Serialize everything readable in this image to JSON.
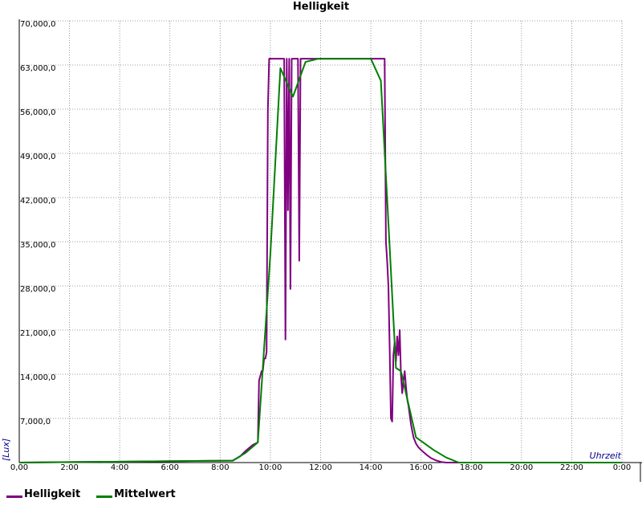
{
  "chart_data": {
    "type": "line",
    "title": "Helligkeit",
    "xlabel": "Uhrzeit",
    "ylabel": "[Lux]",
    "xlim": [
      0,
      24
    ],
    "ylim": [
      0,
      70000
    ],
    "grid": true,
    "legend_position": "bottom-left",
    "x_ticks": [
      {
        "value": 0,
        "label": "0,00"
      },
      {
        "value": 2,
        "label": "2:00"
      },
      {
        "value": 4,
        "label": "4:00"
      },
      {
        "value": 6,
        "label": "6:00"
      },
      {
        "value": 8,
        "label": "8:00"
      },
      {
        "value": 10,
        "label": "10:00"
      },
      {
        "value": 12,
        "label": "12:00"
      },
      {
        "value": 14,
        "label": "14:00"
      },
      {
        "value": 16,
        "label": "16:00"
      },
      {
        "value": 18,
        "label": "18:00"
      },
      {
        "value": 20,
        "label": "20:00"
      },
      {
        "value": 22,
        "label": "22:00"
      },
      {
        "value": 24,
        "label": "0:00"
      }
    ],
    "y_ticks": [
      {
        "value": 7000,
        "label": "7,000,0"
      },
      {
        "value": 14000,
        "label": "14,000,0"
      },
      {
        "value": 21000,
        "label": "21,000,0"
      },
      {
        "value": 28000,
        "label": "28,000,0"
      },
      {
        "value": 35000,
        "label": "35,000,0"
      },
      {
        "value": 42000,
        "label": "42,000,0"
      },
      {
        "value": 49000,
        "label": "49,000,0"
      },
      {
        "value": 56000,
        "label": "56,000,0"
      },
      {
        "value": 63000,
        "label": "63,000,0"
      },
      {
        "value": 70000,
        "label": "70,000,0"
      }
    ],
    "series": [
      {
        "name": "Helligkeit",
        "color": "#800080",
        "x": [
          0,
          8.5,
          8.8,
          9.0,
          9.3,
          9.5,
          9.55,
          9.65,
          9.7,
          9.75,
          9.8,
          9.85,
          9.9,
          9.95,
          10.0,
          10.05,
          10.1,
          10.15,
          10.55,
          10.6,
          10.65,
          10.7,
          10.75,
          10.8,
          10.85,
          10.9,
          10.95,
          11.0,
          11.05,
          11.1,
          11.15,
          11.2,
          11.25,
          14.55,
          14.6,
          14.65,
          14.7,
          14.75,
          14.8,
          14.85,
          14.9,
          14.95,
          15.0,
          15.05,
          15.1,
          15.15,
          15.2,
          15.25,
          15.3,
          15.35,
          15.4,
          15.45,
          15.5,
          15.6,
          15.7,
          15.8,
          15.9,
          16.0,
          16.2,
          16.4,
          16.6,
          16.8,
          17.0,
          17.2,
          17.4,
          17.6,
          18.0,
          24.0
        ],
        "y": [
          0,
          300,
          1000,
          1800,
          2800,
          3200,
          13000,
          14500,
          14500,
          16500,
          16500,
          17500,
          56000,
          64000,
          64000,
          64000,
          64000,
          64000,
          64000,
          19500,
          64000,
          40000,
          64000,
          27500,
          64000,
          64000,
          64000,
          64000,
          64000,
          64000,
          32000,
          64000,
          64000,
          64000,
          35000,
          32000,
          28000,
          18000,
          7000,
          6500,
          17000,
          19000,
          16000,
          20000,
          17000,
          21000,
          14000,
          11000,
          13000,
          14500,
          12000,
          10000,
          9000,
          6000,
          4000,
          3000,
          2400,
          2000,
          1300,
          700,
          350,
          100,
          0,
          0,
          0,
          0,
          0,
          0
        ]
      },
      {
        "name": "Mittelwert",
        "color": "#008000",
        "x": [
          0,
          8.5,
          9.0,
          9.5,
          10.0,
          10.4,
          10.9,
          11.4,
          11.9,
          13.5,
          14.0,
          14.4,
          14.7,
          15.0,
          15.2,
          15.4,
          15.8,
          16.5,
          17.0,
          17.5,
          18.0,
          24.0
        ],
        "y": [
          0,
          300,
          1500,
          3200,
          33000,
          62500,
          58000,
          63500,
          64000,
          64000,
          64000,
          60500,
          38000,
          15000,
          14500,
          11000,
          4000,
          2000,
          800,
          0,
          0,
          0
        ]
      }
    ]
  }
}
